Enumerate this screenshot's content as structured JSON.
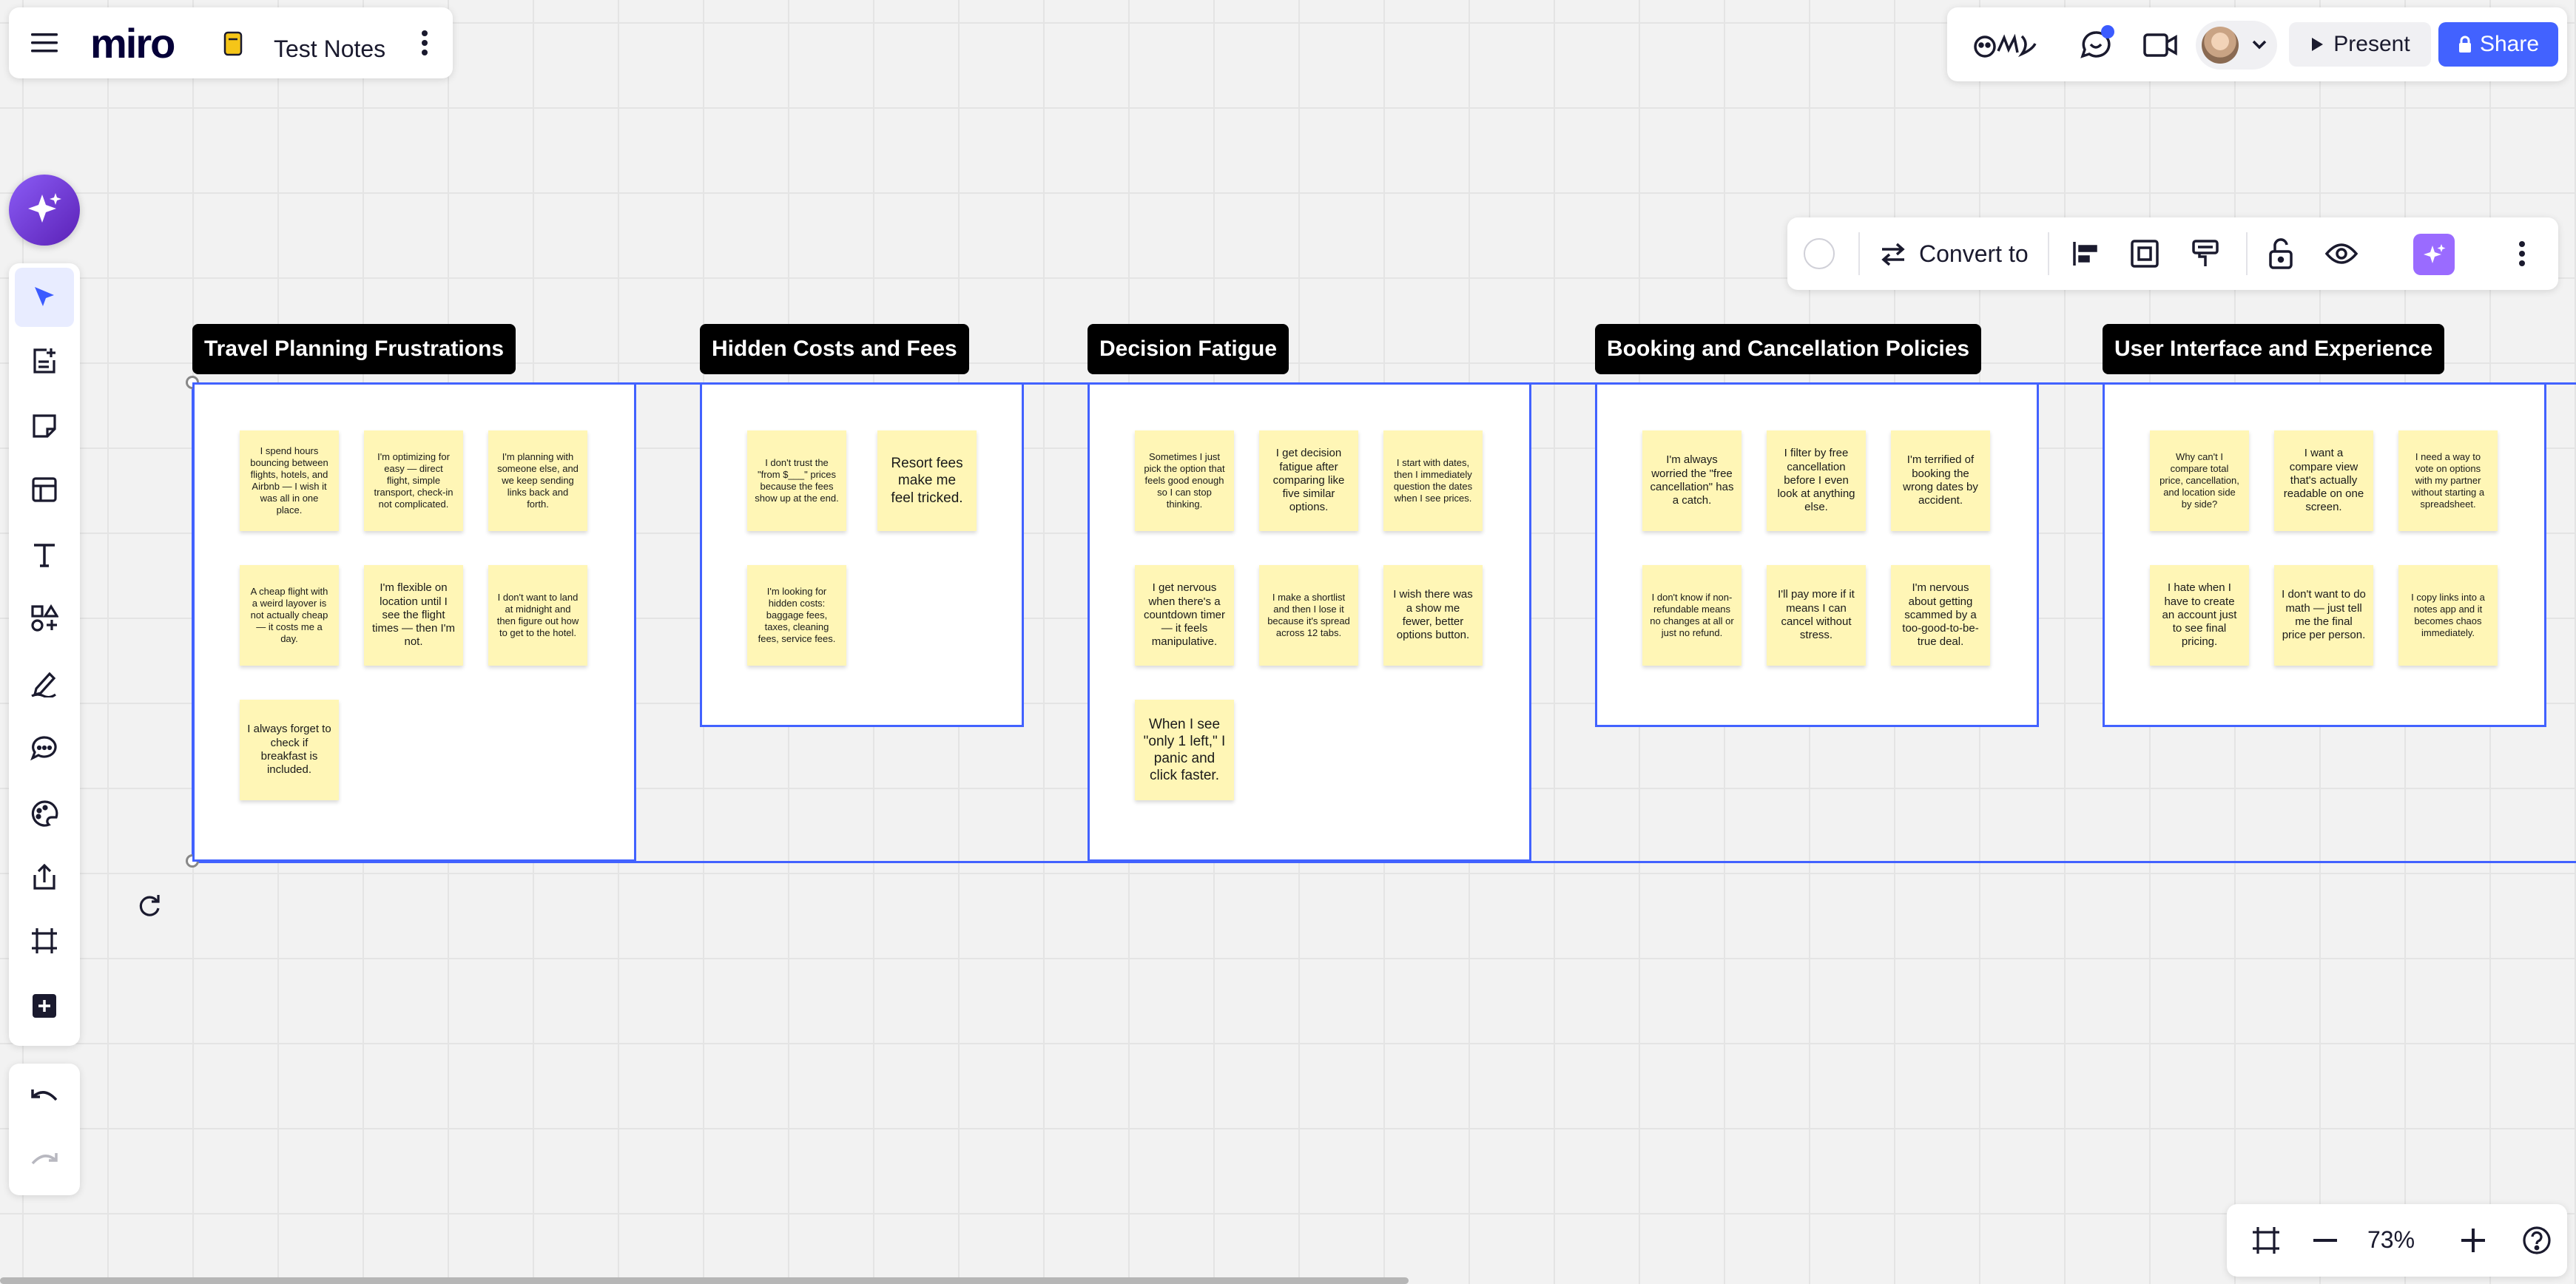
{
  "app": {
    "logo": "miro",
    "board_name": "Test Notes"
  },
  "header": {
    "present_label": "Present",
    "share_label": "Share"
  },
  "context_toolbar": {
    "convert_label": "Convert to"
  },
  "zoom": {
    "value": "73%"
  },
  "frames": [
    {
      "title": "Travel Planning Frustrations",
      "notes": [
        "I spend hours bouncing between flights, hotels, and Airbnb — I wish it was all in one place.",
        "I'm optimizing for easy — direct flight, simple transport, check-in not complicated.",
        "I'm planning with someone else, and we keep sending links back and forth.",
        "A cheap flight with a weird layover is not actually cheap — it costs me a day.",
        "I'm flexible on location until I see the flight times — then I'm not.",
        "I don't want to land at midnight and then figure out how to get to the hotel.",
        "I always forget to check if breakfast is included."
      ]
    },
    {
      "title": "Hidden Costs and Fees",
      "notes": [
        "I don't trust the \"from $___\" prices because the fees show up at the end.",
        "Resort fees make me feel tricked.",
        "I'm looking for hidden costs: baggage fees, taxes, cleaning fees, service fees."
      ]
    },
    {
      "title": "Decision Fatigue",
      "notes": [
        "Sometimes I just pick the option that feels good enough so I can stop thinking.",
        "I get decision fatigue after comparing like five similar options.",
        "I start with dates, then I immediately question the dates when I see prices.",
        "I get nervous when there's a countdown timer — it feels manipulative.",
        "I make a shortlist and then I lose it because it's spread across 12 tabs.",
        "I wish there was a show me fewer, better options button.",
        "When I see \"only 1 left,\" I panic and click faster."
      ]
    },
    {
      "title": "Booking and Cancellation Policies",
      "notes": [
        "I'm always worried the \"free cancellation\" has a catch.",
        "I filter by free cancellation before I even look at anything else.",
        "I'm terrified of booking the wrong dates by accident.",
        "I don't know if non-refundable means no changes at all or just no refund.",
        "I'll pay more if it means I can cancel without stress.",
        "I'm nervous about getting scammed by a too-good-to-be-true deal."
      ]
    },
    {
      "title": "User Interface and Experience",
      "notes": [
        "Why can't I compare total price, cancellation, and location side by side?",
        "I want a compare view that's actually readable on one screen.",
        "I need a way to vote on options with my partner without starting a spreadsheet.",
        "I hate when I have to create an account just to see final pricing.",
        "I don't want to do math — just tell me the final price per person.",
        "I copy links into a notes app and it becomes chaos immediately."
      ]
    }
  ],
  "colors": {
    "accent": "#4262ff",
    "sticky": "#fff6b6",
    "ai": "#7c3aed"
  }
}
